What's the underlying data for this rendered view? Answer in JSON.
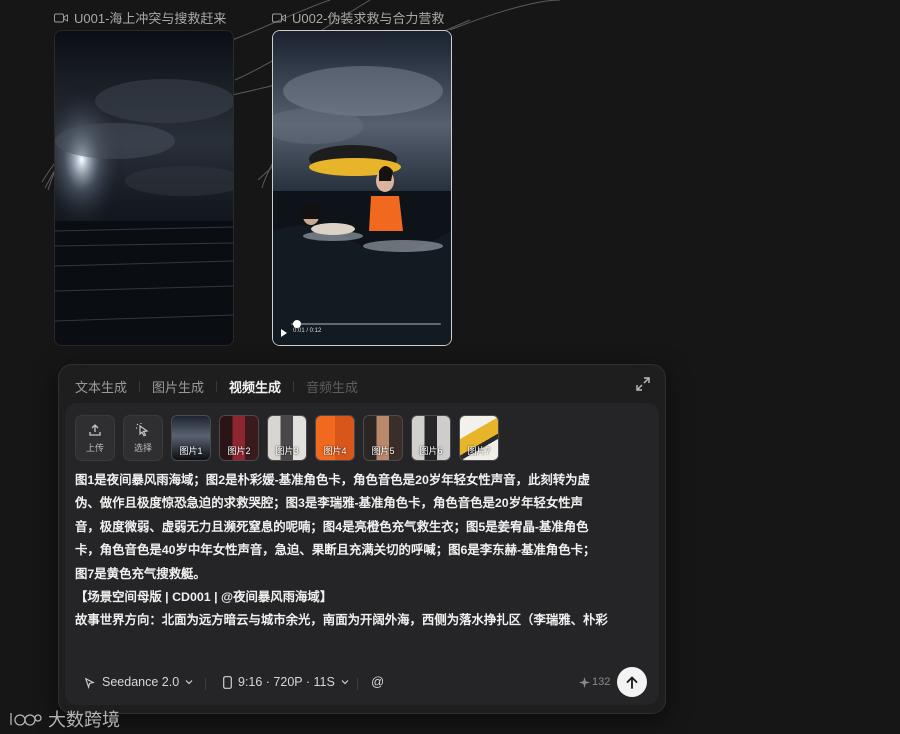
{
  "clips": [
    {
      "title": "U001-海上冲突与搜救赶来"
    },
    {
      "title": "U002-伪装求救与合力营救",
      "player_time": "0:01 / 0:12",
      "progress": 0.08
    }
  ],
  "panel": {
    "tabs": [
      "文本生成",
      "图片生成",
      "视频生成",
      "音频生成"
    ],
    "active_tab": "视频生成",
    "tools": {
      "upload": "上传",
      "select": "选择"
    },
    "thumbnails": [
      "图片1",
      "图片2",
      "图片3",
      "图片4",
      "图片5",
      "图片6",
      "图片7"
    ],
    "prompt_lines": [
      "图1是夜间暴风雨海域；图2是朴彩媛-基准角色卡，角色音色是20岁年轻女性声音，此刻转为虚",
      "伪、做作且极度惊恐急迫的求救哭腔；图3是李瑞雅-基准角色卡，角色音色是20岁年轻女性声",
      "音，极度微弱、虚弱无力且濒死窒息的呢喃；图4是亮橙色充气救生衣；图5是姜宥晶-基准角色",
      "卡，角色音色是40岁中年女性声音，急迫、果断且充满关切的呼喊；图6是李东赫-基准角色卡；",
      "图7是黄色充气搜救艇。",
      "",
      "【场景空间母版 | CD001 | @夜间暴风雨海域】",
      "故事世界方向：北面为远方暗云与城市余光，南面为开阔外海，西侧为落水挣扎区（李瑞雅、朴彩"
    ],
    "model": "Seedance 2.0",
    "spec": "9:16 · 720P · 11S",
    "mention": "@",
    "credits": "132"
  },
  "watermark": "大数跨境",
  "colors": {
    "background": "#161616",
    "panel": "#1e1e1f",
    "inner": "#252527",
    "vest": "#f0691e",
    "raft": "#e8b52a"
  }
}
